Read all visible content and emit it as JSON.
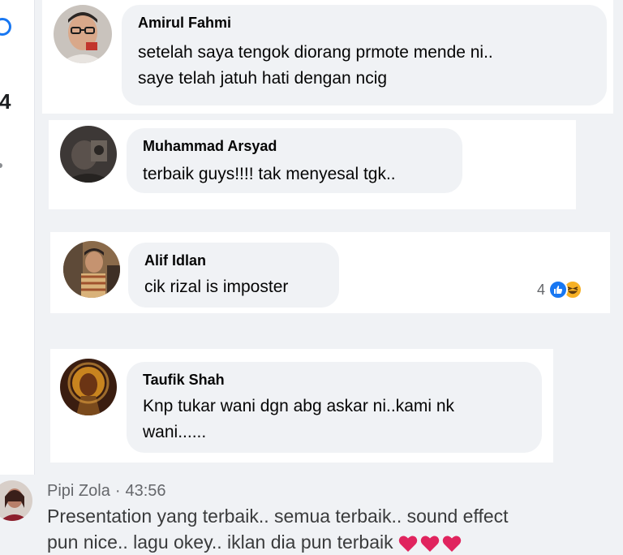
{
  "left_panel": {
    "digit": "4"
  },
  "comments": [
    {
      "author": "Amirul Fahmi",
      "lines": [
        "setelah saya tengok diorang prmote mende ni..",
        "saye telah jatuh hati dengan ncig"
      ]
    },
    {
      "author": "Muhammad Arsyad",
      "lines": [
        "terbaik guys!!!! tak menyesal tgk.."
      ]
    },
    {
      "author": "Alif Idlan",
      "lines": [
        "cik rizal is imposter"
      ],
      "reactions": {
        "count": "4",
        "icons": [
          "like-icon",
          "haha-icon"
        ]
      }
    },
    {
      "author": "Taufik Shah",
      "lines": [
        "Knp tukar wani dgn abg askar ni..kami nk",
        "wani......"
      ]
    }
  ],
  "live_comment": {
    "author": "Pipi Zola",
    "separator": "·",
    "timestamp": "43:56",
    "lines": [
      "Presentation yang terbaik.. semua terbaik.. sound effect",
      "pun nice.. lagu okey.. iklan dia pun terbaik"
    ],
    "emoji": [
      "heart-icon",
      "heart-icon",
      "heart-icon"
    ]
  },
  "colors": {
    "accent": "#1877f2",
    "bubble": "#f0f2f5",
    "like": "#1877f2",
    "haha": "#f7b125",
    "heart": "#e0245e"
  }
}
